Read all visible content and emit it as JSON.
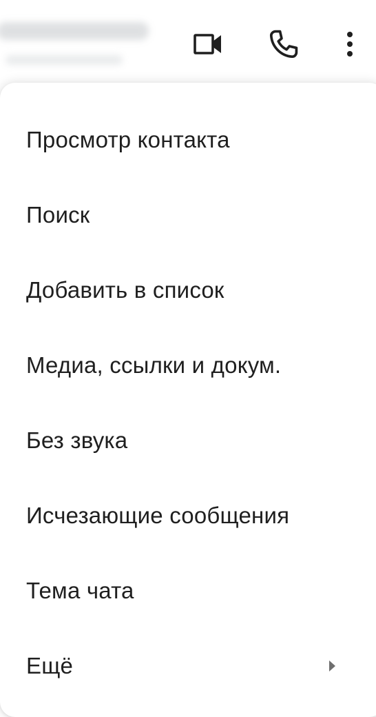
{
  "header": {
    "icons": [
      {
        "name": "video-call-icon"
      },
      {
        "name": "voice-call-icon"
      },
      {
        "name": "more-options-icon"
      }
    ]
  },
  "menu": {
    "items": [
      {
        "label": "Просмотр контакта"
      },
      {
        "label": "Поиск"
      },
      {
        "label": "Добавить в список"
      },
      {
        "label": "Медиа, ссылки и докум."
      },
      {
        "label": "Без звука"
      },
      {
        "label": "Исчезающие сообщения"
      },
      {
        "label": "Тема чата"
      },
      {
        "label": "Ещё",
        "has_submenu": true
      }
    ]
  },
  "colors": {
    "text": "#1f1f1f",
    "icon": "#1f1f1f",
    "menu_background": "#ffffff",
    "submenu_arrow": "#6f6f6f"
  }
}
